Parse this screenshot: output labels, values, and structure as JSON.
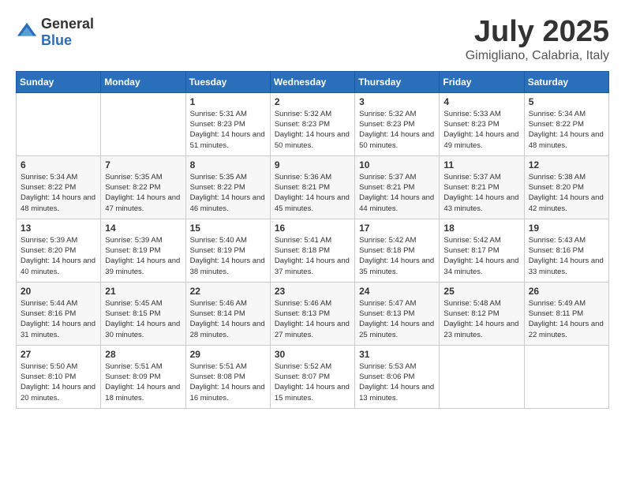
{
  "header": {
    "logo_general": "General",
    "logo_blue": "Blue",
    "month_year": "July 2025",
    "location": "Gimigliano, Calabria, Italy"
  },
  "days_of_week": [
    "Sunday",
    "Monday",
    "Tuesday",
    "Wednesday",
    "Thursday",
    "Friday",
    "Saturday"
  ],
  "weeks": [
    [
      {
        "day": "",
        "info": ""
      },
      {
        "day": "",
        "info": ""
      },
      {
        "day": "1",
        "info": "Sunrise: 5:31 AM\nSunset: 8:23 PM\nDaylight: 14 hours and 51 minutes."
      },
      {
        "day": "2",
        "info": "Sunrise: 5:32 AM\nSunset: 8:23 PM\nDaylight: 14 hours and 50 minutes."
      },
      {
        "day": "3",
        "info": "Sunrise: 5:32 AM\nSunset: 8:23 PM\nDaylight: 14 hours and 50 minutes."
      },
      {
        "day": "4",
        "info": "Sunrise: 5:33 AM\nSunset: 8:23 PM\nDaylight: 14 hours and 49 minutes."
      },
      {
        "day": "5",
        "info": "Sunrise: 5:34 AM\nSunset: 8:22 PM\nDaylight: 14 hours and 48 minutes."
      }
    ],
    [
      {
        "day": "6",
        "info": "Sunrise: 5:34 AM\nSunset: 8:22 PM\nDaylight: 14 hours and 48 minutes."
      },
      {
        "day": "7",
        "info": "Sunrise: 5:35 AM\nSunset: 8:22 PM\nDaylight: 14 hours and 47 minutes."
      },
      {
        "day": "8",
        "info": "Sunrise: 5:35 AM\nSunset: 8:22 PM\nDaylight: 14 hours and 46 minutes."
      },
      {
        "day": "9",
        "info": "Sunrise: 5:36 AM\nSunset: 8:21 PM\nDaylight: 14 hours and 45 minutes."
      },
      {
        "day": "10",
        "info": "Sunrise: 5:37 AM\nSunset: 8:21 PM\nDaylight: 14 hours and 44 minutes."
      },
      {
        "day": "11",
        "info": "Sunrise: 5:37 AM\nSunset: 8:21 PM\nDaylight: 14 hours and 43 minutes."
      },
      {
        "day": "12",
        "info": "Sunrise: 5:38 AM\nSunset: 8:20 PM\nDaylight: 14 hours and 42 minutes."
      }
    ],
    [
      {
        "day": "13",
        "info": "Sunrise: 5:39 AM\nSunset: 8:20 PM\nDaylight: 14 hours and 40 minutes."
      },
      {
        "day": "14",
        "info": "Sunrise: 5:39 AM\nSunset: 8:19 PM\nDaylight: 14 hours and 39 minutes."
      },
      {
        "day": "15",
        "info": "Sunrise: 5:40 AM\nSunset: 8:19 PM\nDaylight: 14 hours and 38 minutes."
      },
      {
        "day": "16",
        "info": "Sunrise: 5:41 AM\nSunset: 8:18 PM\nDaylight: 14 hours and 37 minutes."
      },
      {
        "day": "17",
        "info": "Sunrise: 5:42 AM\nSunset: 8:18 PM\nDaylight: 14 hours and 35 minutes."
      },
      {
        "day": "18",
        "info": "Sunrise: 5:42 AM\nSunset: 8:17 PM\nDaylight: 14 hours and 34 minutes."
      },
      {
        "day": "19",
        "info": "Sunrise: 5:43 AM\nSunset: 8:16 PM\nDaylight: 14 hours and 33 minutes."
      }
    ],
    [
      {
        "day": "20",
        "info": "Sunrise: 5:44 AM\nSunset: 8:16 PM\nDaylight: 14 hours and 31 minutes."
      },
      {
        "day": "21",
        "info": "Sunrise: 5:45 AM\nSunset: 8:15 PM\nDaylight: 14 hours and 30 minutes."
      },
      {
        "day": "22",
        "info": "Sunrise: 5:46 AM\nSunset: 8:14 PM\nDaylight: 14 hours and 28 minutes."
      },
      {
        "day": "23",
        "info": "Sunrise: 5:46 AM\nSunset: 8:13 PM\nDaylight: 14 hours and 27 minutes."
      },
      {
        "day": "24",
        "info": "Sunrise: 5:47 AM\nSunset: 8:13 PM\nDaylight: 14 hours and 25 minutes."
      },
      {
        "day": "25",
        "info": "Sunrise: 5:48 AM\nSunset: 8:12 PM\nDaylight: 14 hours and 23 minutes."
      },
      {
        "day": "26",
        "info": "Sunrise: 5:49 AM\nSunset: 8:11 PM\nDaylight: 14 hours and 22 minutes."
      }
    ],
    [
      {
        "day": "27",
        "info": "Sunrise: 5:50 AM\nSunset: 8:10 PM\nDaylight: 14 hours and 20 minutes."
      },
      {
        "day": "28",
        "info": "Sunrise: 5:51 AM\nSunset: 8:09 PM\nDaylight: 14 hours and 18 minutes."
      },
      {
        "day": "29",
        "info": "Sunrise: 5:51 AM\nSunset: 8:08 PM\nDaylight: 14 hours and 16 minutes."
      },
      {
        "day": "30",
        "info": "Sunrise: 5:52 AM\nSunset: 8:07 PM\nDaylight: 14 hours and 15 minutes."
      },
      {
        "day": "31",
        "info": "Sunrise: 5:53 AM\nSunset: 8:06 PM\nDaylight: 14 hours and 13 minutes."
      },
      {
        "day": "",
        "info": ""
      },
      {
        "day": "",
        "info": ""
      }
    ]
  ]
}
